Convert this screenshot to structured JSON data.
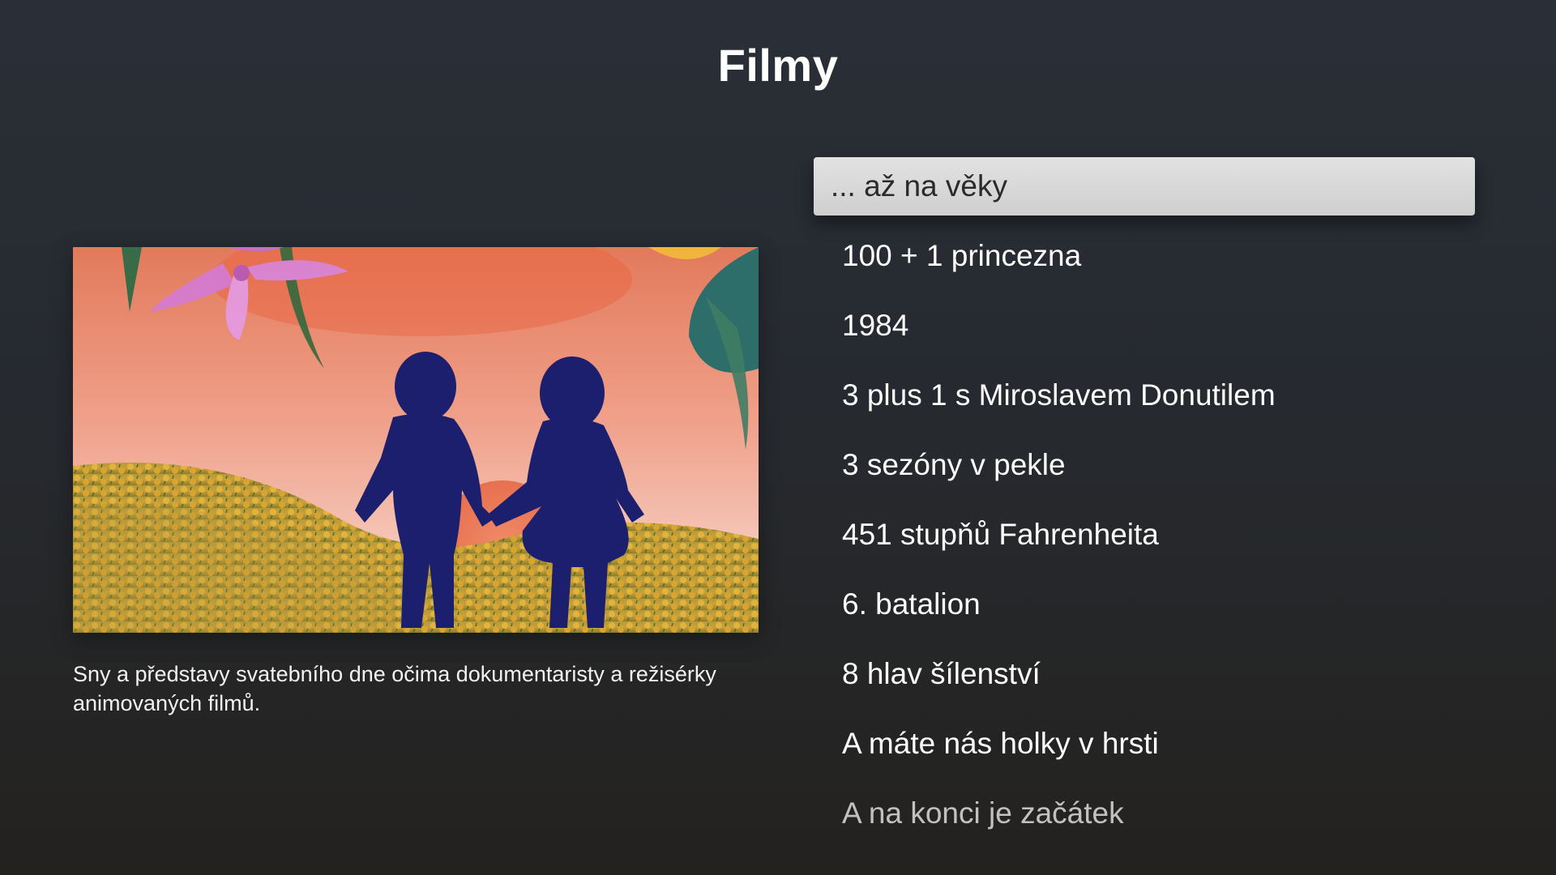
{
  "header": {
    "title": "Filmy"
  },
  "preview": {
    "image": "animated-children-silhouettes-sunset-meadow",
    "description": "Sny a představy svatebního dne očima dokumentaristy a režisérky animovaných filmů."
  },
  "menu": {
    "selected_index": 0,
    "items": [
      {
        "label": "... až na věky"
      },
      {
        "label": "100 + 1 princezna"
      },
      {
        "label": "1984"
      },
      {
        "label": "3 plus 1 s Miroslavem Donutilem"
      },
      {
        "label": "3 sezóny v pekle"
      },
      {
        "label": "451 stupňů Fahrenheita"
      },
      {
        "label": "6. batalion"
      },
      {
        "label": "8 hlav šílenství"
      },
      {
        "label": "A máte nás holky v hrsti"
      },
      {
        "label": "A na konci je začátek"
      }
    ]
  },
  "colors": {
    "background": "#272b31",
    "focus_highlight": "#d8d8d8",
    "focus_text": "#2b2b2b",
    "text": "#ffffff"
  }
}
